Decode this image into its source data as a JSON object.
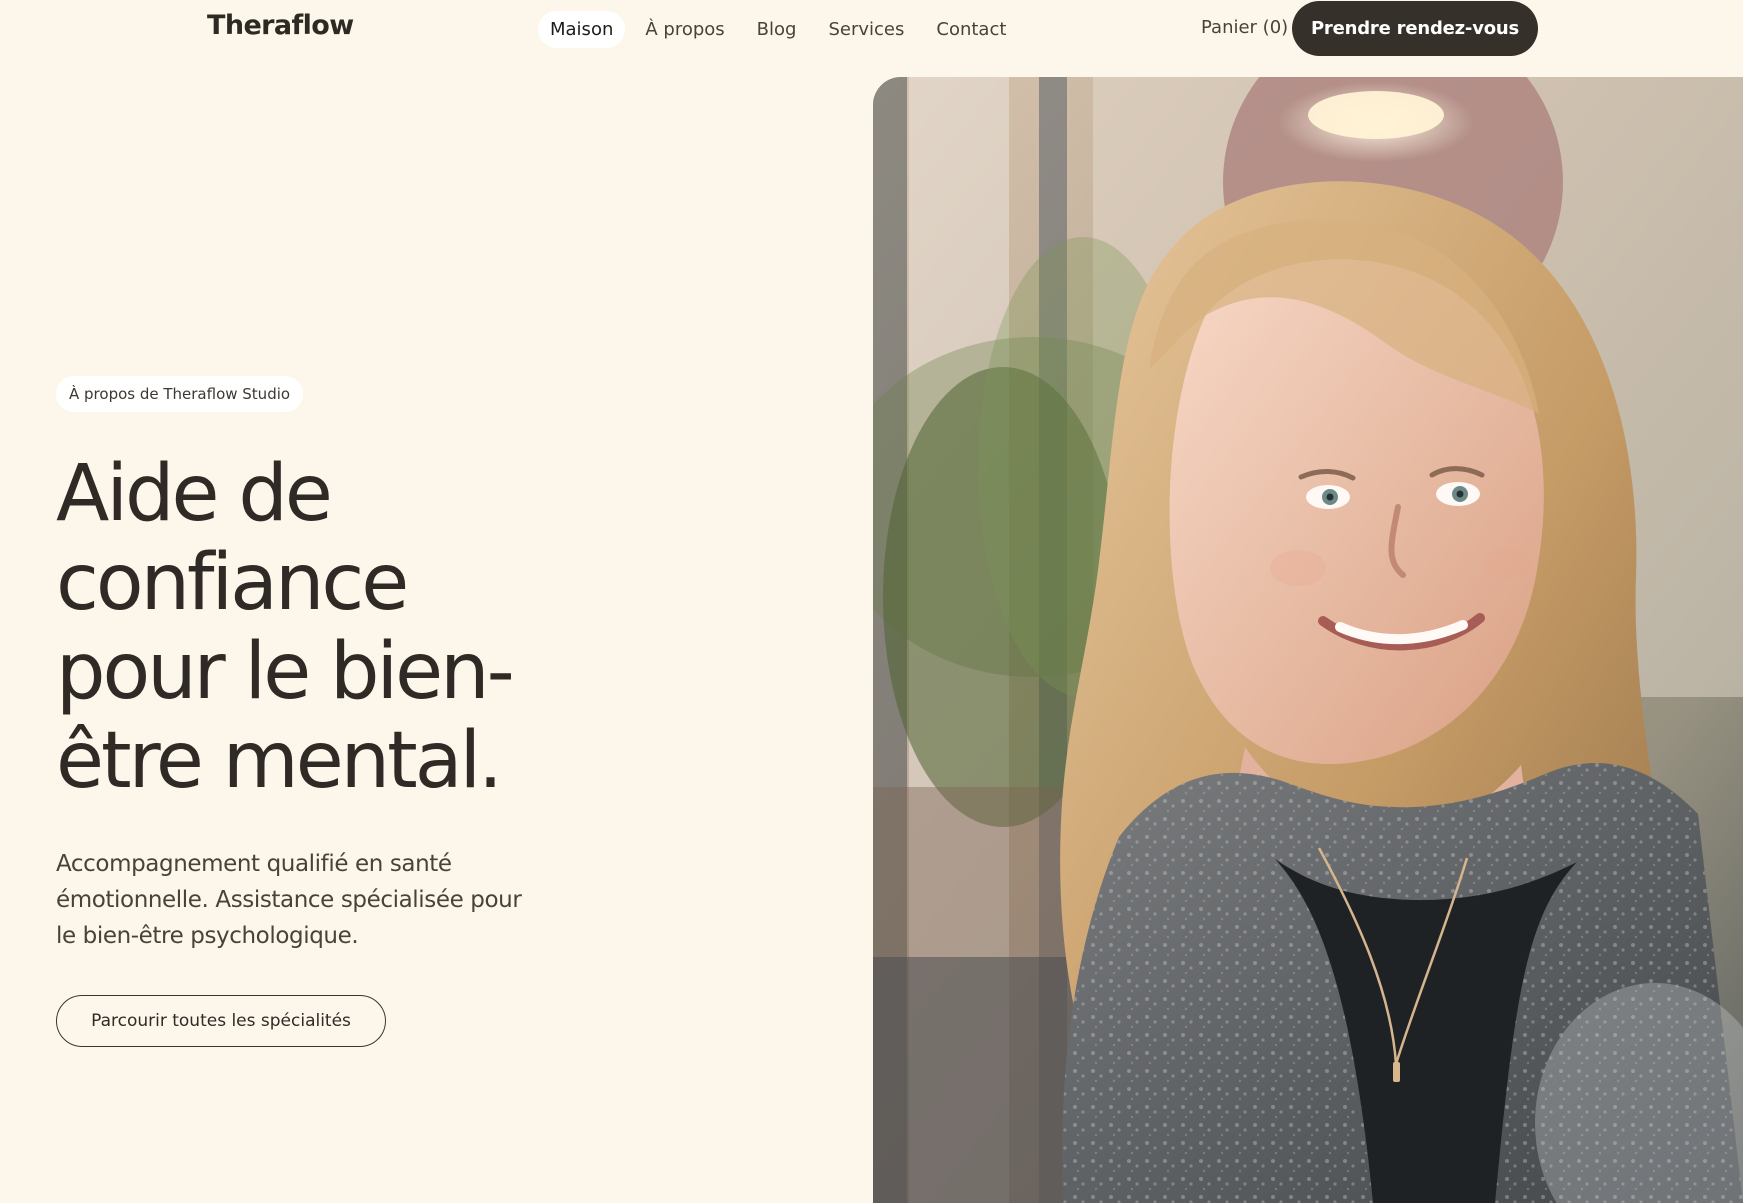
{
  "brand": {
    "name": "Theraflow"
  },
  "nav": {
    "items": [
      {
        "label": "Maison"
      },
      {
        "label": "À propos"
      },
      {
        "label": "Blog"
      },
      {
        "label": "Services"
      },
      {
        "label": "Contact"
      }
    ]
  },
  "header_actions": {
    "cart_label": "Panier (0)",
    "book_label": "Prendre rendez-vous"
  },
  "hero": {
    "eyebrow": "À propos de Theraflow Studio",
    "title_lines": [
      "Aide de",
      "confiance",
      "pour le bien-",
      "être mental."
    ],
    "description": "Accompagnement qualifié en santé émotionnelle. Assistance spécialisée pour le bien-être psychologique.",
    "browse_label": "Parcourir toutes les spécialités"
  },
  "colors": {
    "background": "#fdf7eb",
    "text": "#35302a",
    "button_dark": "#36302b",
    "pill_background": "#ffffff"
  }
}
